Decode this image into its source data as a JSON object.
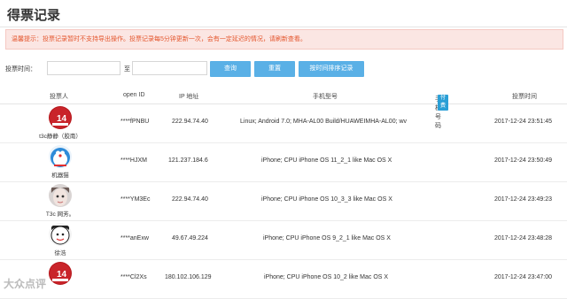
{
  "page": {
    "title": "得票记录",
    "alert": "温馨提示：投票记录暂时不支持导出操作。投票记录每5分钟更新一次，会有一定延迟的情况，请刷新查看。"
  },
  "search": {
    "label": "投票时间：",
    "start_value": "",
    "end_value": "",
    "range_separator": "至",
    "query_button": "查询",
    "clear_button": "重置",
    "sort_button": "按时间排序记录"
  },
  "table": {
    "headers": {
      "voter": "投票人",
      "open_id": "open ID",
      "ip": "IP 地址",
      "device": "手机型号",
      "phone": "手机号码",
      "phone_badge": "付费",
      "time": "投票时间"
    },
    "rows": [
      {
        "name": "t3c静静（胶南）",
        "open_id": "****fPNBU",
        "ip": "222.94.74.40",
        "device": "Linux; Android 7.0; MHA-AL00 Build/HUAWEIMHA-AL00; wv",
        "time": "2017-12-24 23:51:45",
        "avatar": "red-badge-14-avatar"
      },
      {
        "name": "机器猫",
        "open_id": "****HJXM",
        "ip": "121.237.184.6",
        "device": "iPhone; CPU iPhone OS 11_2_1 like Mac OS X",
        "time": "2017-12-24 23:50:49",
        "avatar": "doraemon-avatar"
      },
      {
        "name": "T3c 网芳。",
        "open_id": "****YM3Ec",
        "ip": "222.94.74.40",
        "device": "iPhone; CPU iPhone OS 10_3_3 like Mac OS X",
        "time": "2017-12-24 23:49:23",
        "avatar": "girl-photo-avatar"
      },
      {
        "name": "徐浩",
        "open_id": "****anExw",
        "ip": "49.67.49.224",
        "device": "iPhone; CPU iPhone OS 9_2_1 like Mac OS X",
        "time": "2017-12-24 23:48:28",
        "avatar": "cartoon-face-avatar"
      },
      {
        "name": "",
        "open_id": "****Cl2Xs",
        "ip": "180.102.106.129",
        "device": "iPhone; CPU iPhone OS 10_2 like Mac OS X",
        "time": "2017-12-24 23:47:00",
        "avatar": "red-badge-14-avatar"
      }
    ]
  },
  "watermark": "大众点评",
  "colors": {
    "accent": "#5ab0e6",
    "alert_text": "#e4572e",
    "alert_bg": "#fbe6e3"
  }
}
